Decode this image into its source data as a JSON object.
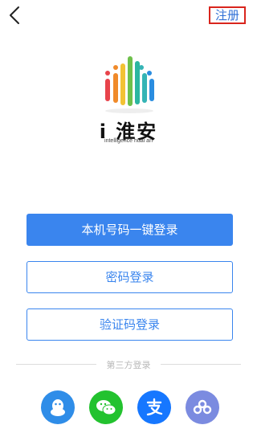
{
  "header": {
    "register_label": "注册",
    "back_icon": "chevron-left-icon"
  },
  "brand": {
    "name": "i 淮安",
    "tagline": "intelligence huai an"
  },
  "login": {
    "primary_label": "本机号码一键登录",
    "password_label": "密码登录",
    "code_label": "验证码登录"
  },
  "third_party": {
    "label": "第三方登录",
    "icons": [
      "qq-icon",
      "wechat-icon",
      "alipay-icon",
      "weibo-cloud-icon"
    ]
  },
  "colors": {
    "accent": "#3a85ee",
    "register_highlight": "#d9251d",
    "qq": "#2f8de8",
    "wechat": "#23c22f",
    "alipay": "#1677ff",
    "purple": "#7b8be0"
  }
}
